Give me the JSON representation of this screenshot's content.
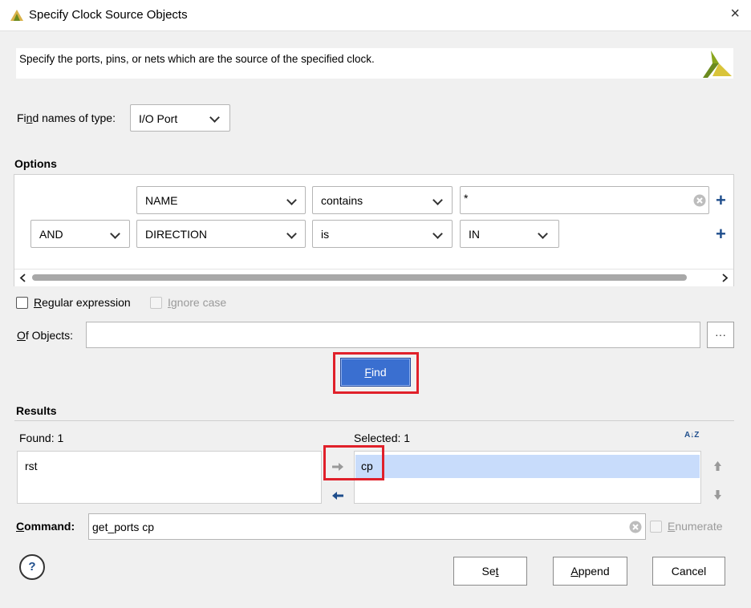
{
  "window": {
    "title": "Specify Clock Source Objects",
    "close": "×"
  },
  "banner": {
    "text": "Specify the ports, pins, or nets which are the source of the specified clock."
  },
  "find_type": {
    "label_pre": "Fi",
    "label_ul": "n",
    "label_post": "d names of type:",
    "value": "I/O Port"
  },
  "options": {
    "heading": "Options",
    "row1": {
      "property": "NAME",
      "operator": "contains",
      "value": "*"
    },
    "row2": {
      "logic": "AND",
      "property": "DIRECTION",
      "operator": "is",
      "value": "IN"
    },
    "add_icon": "+"
  },
  "regex": {
    "label_ul": "R",
    "label_rest": "egular expression",
    "checked": false
  },
  "ignore_case": {
    "label_ul": "I",
    "label_rest": "gnore case",
    "enabled": false
  },
  "of_objects": {
    "label_ul": "O",
    "label_rest": "f Objects:",
    "value": "",
    "browse": "···"
  },
  "find_button": {
    "label_ul": "F",
    "label_rest": "ind"
  },
  "results": {
    "heading": "Results",
    "found_label": "Found: 1",
    "found_items": [
      "rst"
    ],
    "selected_label": "Selected: 1",
    "selected_items": [
      "cp"
    ],
    "sort_icon": "A↓Z"
  },
  "command": {
    "label_ul": "C",
    "label_rest": "ommand:",
    "value": "get_ports cp"
  },
  "enumerate": {
    "label_ul": "E",
    "label_rest": "numerate",
    "enabled": false
  },
  "buttons": {
    "help": "?",
    "set_pre": "Se",
    "set_ul": "t",
    "append_ul": "A",
    "append_rest": "ppend",
    "cancel": "Cancel"
  },
  "colors": {
    "accent": "#3a6fd0",
    "highlight_red": "#e0202a",
    "selection": "#c8dcfb",
    "nav_blue": "#1f4e8c"
  }
}
